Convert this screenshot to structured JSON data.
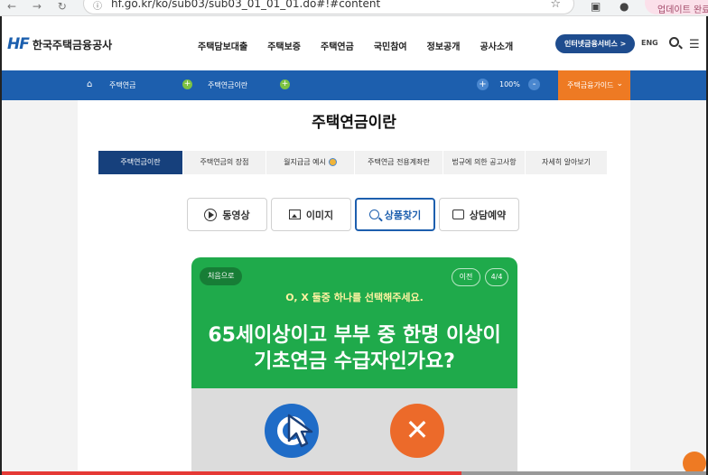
{
  "browser": {
    "nav_back": "←",
    "nav_forward": "→",
    "nav_reload": "↻",
    "url": "hf.go.kr/ko/sub03/sub03_01_01_01.do#!#content",
    "profile_label": "업데이트 완료"
  },
  "header": {
    "logo_mark": "HF",
    "logo_text": "한국주택금융공사",
    "gnb": [
      "주택담보대출",
      "주택보증",
      "주택연금",
      "국민참여",
      "정보공개",
      "공사소개"
    ],
    "service_button": "인터넷금융서비스 >",
    "lang": "ENG"
  },
  "subnav": {
    "crumb1": "주택연금",
    "crumb2": "주택연금이란",
    "zoom_out": "+",
    "zoom_value": "100%",
    "zoom_in": "-",
    "guide_label": "주택금융가이드",
    "guide_caret": "⌄"
  },
  "page": {
    "title": "주택연금이란",
    "tabs": [
      "주택연금이란",
      "주택연금의 장점",
      "월지급금 예시",
      "주택연금 전용계좌란",
      "법규에 의한 공고사항",
      "자세히 알아보기"
    ],
    "active_tab": 0
  },
  "media_buttons": {
    "video": "동영상",
    "image": "이미지",
    "search": "상품찾기",
    "consult": "상담예약"
  },
  "quiz": {
    "back_to_start": "처음으로",
    "prev": "이전",
    "page": "4/4",
    "instruction": "O, X 둘중 하나를 선택해주세요.",
    "question_line1": "65세이상이고 부부 중 한명 이상이",
    "question_line2": "기초연금 수급자인가요?",
    "no_mark": "✕"
  },
  "colors": {
    "brand_blue": "#1d5fae",
    "nav_dark": "#16407c",
    "card_green": "#1faa4b",
    "guide_orange": "#ee7a23",
    "x_orange": "#ec6a2a"
  }
}
